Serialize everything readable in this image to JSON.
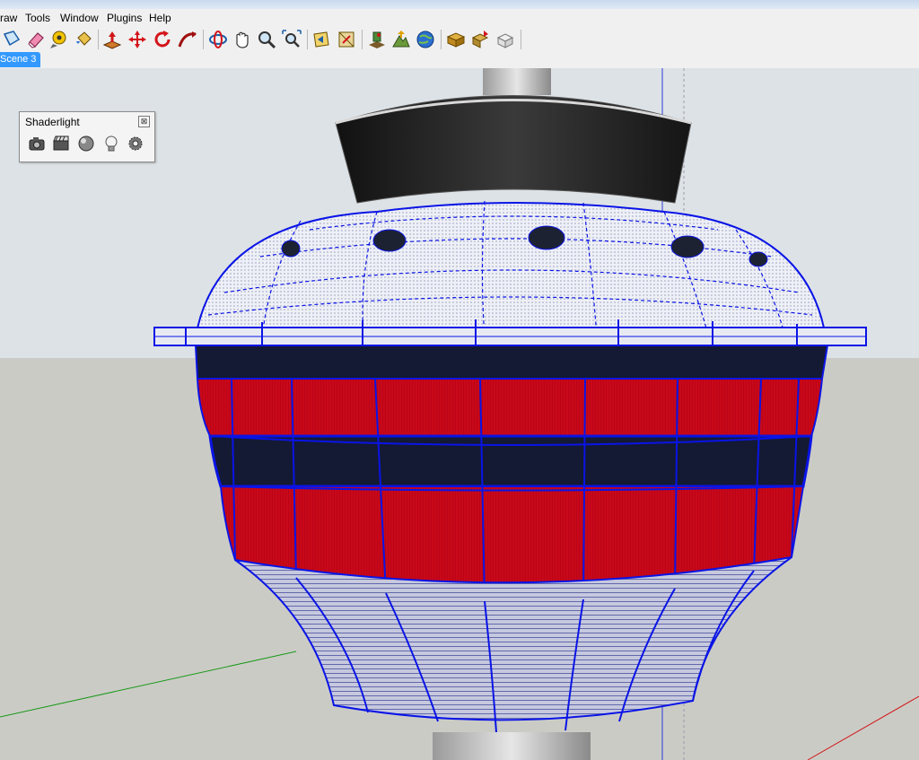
{
  "menu": {
    "items": [
      "raw",
      "Tools",
      "Window",
      "Plugins",
      "Help"
    ]
  },
  "toolbar": {
    "buttons": [
      "select-icon",
      "eraser-icon",
      "tape-measure-icon",
      "paint-bucket-icon",
      "push-pull-icon",
      "move-icon",
      "rotate-icon",
      "follow-me-icon",
      "orbit-icon",
      "pan-icon",
      "zoom-icon",
      "zoom-extents-icon",
      "previous-view-icon",
      "section-plane-icon",
      "add-location-icon",
      "toggle-terrain-icon",
      "google-earth-icon",
      "get-models-icon",
      "share-model-icon",
      "share-component-icon"
    ]
  },
  "scenes": {
    "active_tab": "Scene 3"
  },
  "shaderlight": {
    "title": "Shaderlight",
    "close_symbol": "⊠",
    "buttons": [
      "render-camera-icon",
      "animation-icon",
      "material-sphere-icon",
      "light-bulb-icon",
      "settings-gear-icon"
    ]
  },
  "colors": {
    "sky": "#dde2e6",
    "ground": "#cbcbc6",
    "cabin_red": "#c8081a",
    "window_band": "#141a33",
    "edge_blue": "#0a14e6",
    "dome_white": "#f2f2f8",
    "roof_black": "#2a2a2a",
    "selection_tab": "#3399ff"
  }
}
